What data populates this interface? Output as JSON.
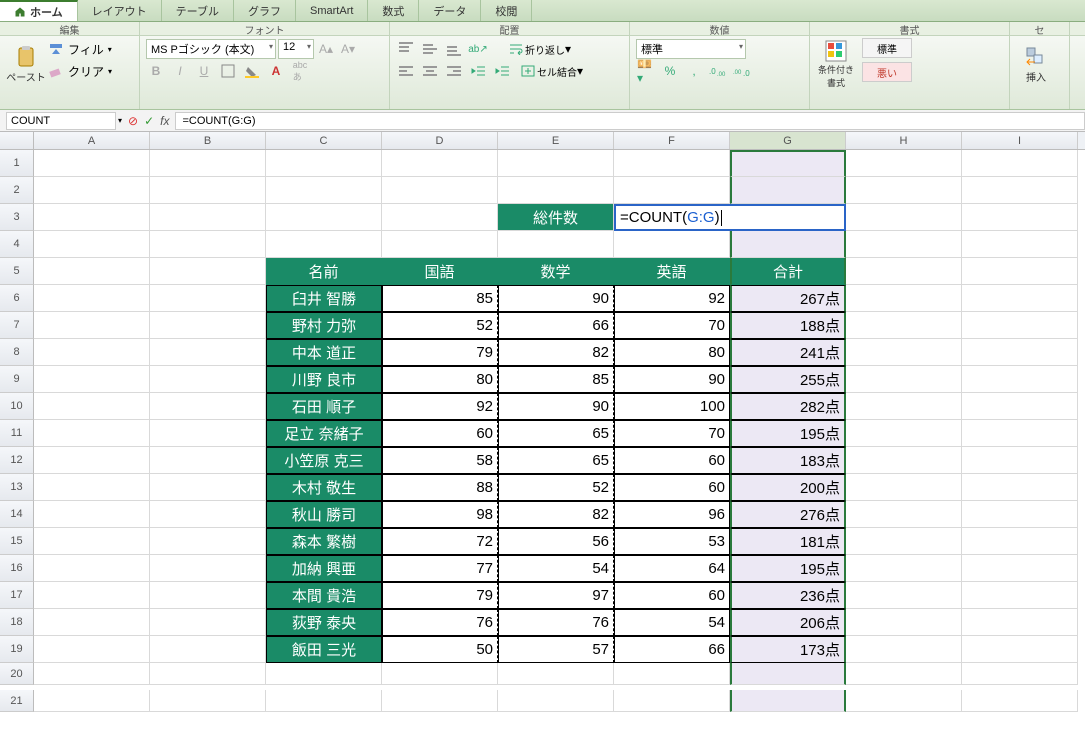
{
  "ribbon": {
    "tabs": [
      "ホーム",
      "レイアウト",
      "テーブル",
      "グラフ",
      "SmartArt",
      "数式",
      "データ",
      "校閲"
    ],
    "group_labels": [
      "編集",
      "フォント",
      "配置",
      "数値",
      "書式",
      "セ"
    ],
    "edit": {
      "fill": "フィル",
      "clear": "クリア",
      "paste": "ペースト"
    },
    "font": {
      "name": "MS Pゴシック (本文)",
      "size": "12"
    },
    "align": {
      "wrap": "折り返し",
      "merge": "セル結合"
    },
    "number": {
      "format": "標準"
    },
    "format": {
      "cond": "条件付き書式",
      "style1": "標準",
      "style2": "悪い"
    },
    "insert": "挿入"
  },
  "formula_bar": {
    "name": "COUNT",
    "formula": "=COUNT(G:G)"
  },
  "columns": [
    "A",
    "B",
    "C",
    "D",
    "E",
    "F",
    "G",
    "H",
    "I"
  ],
  "row3": {
    "label": "総件数",
    "input_plain": "=COUNT(",
    "input_ref": "G:G",
    "input_tail": ")"
  },
  "headers": {
    "c": "名前",
    "d": "国語",
    "e": "数学",
    "f": "英語",
    "g": "合計"
  },
  "data": [
    {
      "name": "臼井 智勝",
      "d": 85,
      "e": 90,
      "f": 92,
      "g": "267点"
    },
    {
      "name": "野村 力弥",
      "d": 52,
      "e": 66,
      "f": 70,
      "g": "188点"
    },
    {
      "name": "中本 道正",
      "d": 79,
      "e": 82,
      "f": 80,
      "g": "241点"
    },
    {
      "name": "川野 良市",
      "d": 80,
      "e": 85,
      "f": 90,
      "g": "255点"
    },
    {
      "name": "石田 順子",
      "d": 92,
      "e": 90,
      "f": 100,
      "g": "282点"
    },
    {
      "name": "足立 奈緒子",
      "d": 60,
      "e": 65,
      "f": 70,
      "g": "195点"
    },
    {
      "name": "小笠原 克三",
      "d": 58,
      "e": 65,
      "f": 60,
      "g": "183点"
    },
    {
      "name": "木村 敬生",
      "d": 88,
      "e": 52,
      "f": 60,
      "g": "200点"
    },
    {
      "name": "秋山 勝司",
      "d": 98,
      "e": 82,
      "f": 96,
      "g": "276点"
    },
    {
      "name": "森本 繁樹",
      "d": 72,
      "e": 56,
      "f": 53,
      "g": "181点"
    },
    {
      "name": "加納 興亜",
      "d": 77,
      "e": 54,
      "f": 64,
      "g": "195点"
    },
    {
      "name": "本間 貴浩",
      "d": 79,
      "e": 97,
      "f": 60,
      "g": "236点"
    },
    {
      "name": "荻野 泰央",
      "d": 76,
      "e": 76,
      "f": 54,
      "g": "206点"
    },
    {
      "name": "飯田 三光",
      "d": 50,
      "e": 57,
      "f": 66,
      "g": "173点"
    }
  ]
}
